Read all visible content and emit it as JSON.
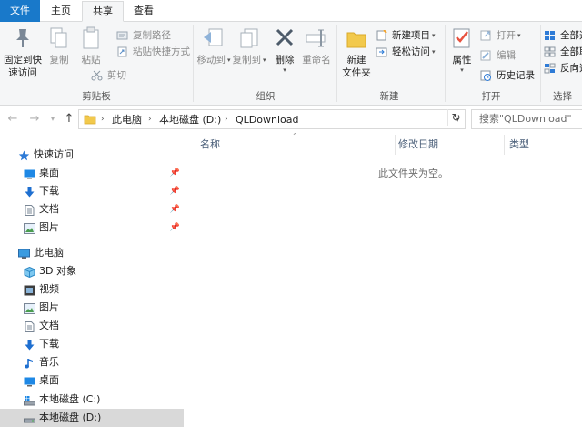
{
  "ribbon_tabs": {
    "file": "文件",
    "home": "主页",
    "share": "共享",
    "view": "查看"
  },
  "ribbon": {
    "clipboard": {
      "label": "剪贴板",
      "pin_quick_access": "固定到快速访问",
      "pin_line1": "固定到快",
      "pin_line2": "速访问",
      "copy": "复制",
      "paste": "粘贴",
      "copy_path": "复制路径",
      "paste_shortcut": "粘贴快捷方式",
      "cut": "剪切"
    },
    "organize": {
      "label": "组织",
      "move_to": "移动到",
      "copy_to": "复制到",
      "delete": "删除",
      "rename": "重命名"
    },
    "new": {
      "label": "新建",
      "new_folder_line1": "新建",
      "new_folder_line2": "文件夹",
      "new_item": "新建项目",
      "easy_access": "轻松访问"
    },
    "open": {
      "label": "打开",
      "properties": "属性",
      "open": "打开",
      "edit": "编辑",
      "history": "历史记录"
    },
    "select": {
      "label": "选择",
      "select_all": "全部选",
      "select_none": "全部取",
      "invert": "反向选"
    }
  },
  "address": {
    "crumbs": [
      "此电脑",
      "本地磁盘 (D:)",
      "QLDownload"
    ],
    "search_placeholder": "搜索\"QLDownload\""
  },
  "nav_pane": {
    "quick_access": "快速访问",
    "quick_items": [
      {
        "label": "桌面",
        "icon": "desktop-icon"
      },
      {
        "label": "下载",
        "icon": "download-icon"
      },
      {
        "label": "文档",
        "icon": "document-icon"
      },
      {
        "label": "图片",
        "icon": "picture-icon"
      }
    ],
    "this_pc": "此电脑",
    "pc_items": [
      {
        "label": "3D 对象",
        "icon": "3d-objects-icon"
      },
      {
        "label": "视频",
        "icon": "video-icon"
      },
      {
        "label": "图片",
        "icon": "picture-icon"
      },
      {
        "label": "文档",
        "icon": "document-icon"
      },
      {
        "label": "下载",
        "icon": "download-icon"
      },
      {
        "label": "音乐",
        "icon": "music-icon"
      },
      {
        "label": "桌面",
        "icon": "desktop-icon"
      },
      {
        "label": "本地磁盘 (C:)",
        "icon": "windows-drive-icon"
      },
      {
        "label": "本地磁盘 (D:)",
        "icon": "drive-icon"
      }
    ]
  },
  "content": {
    "columns": {
      "name": "名称",
      "modified": "修改日期",
      "type": "类型"
    },
    "empty_message": "此文件夹为空。"
  },
  "colors": {
    "file_tab": "#1979ca",
    "ribbon_bg": "#f5f6f7",
    "selected_row": "#d9d9d9",
    "column_header": "#4c607a",
    "folder_yellow": "#f2c94c",
    "accent_blue": "#1e88e5"
  }
}
